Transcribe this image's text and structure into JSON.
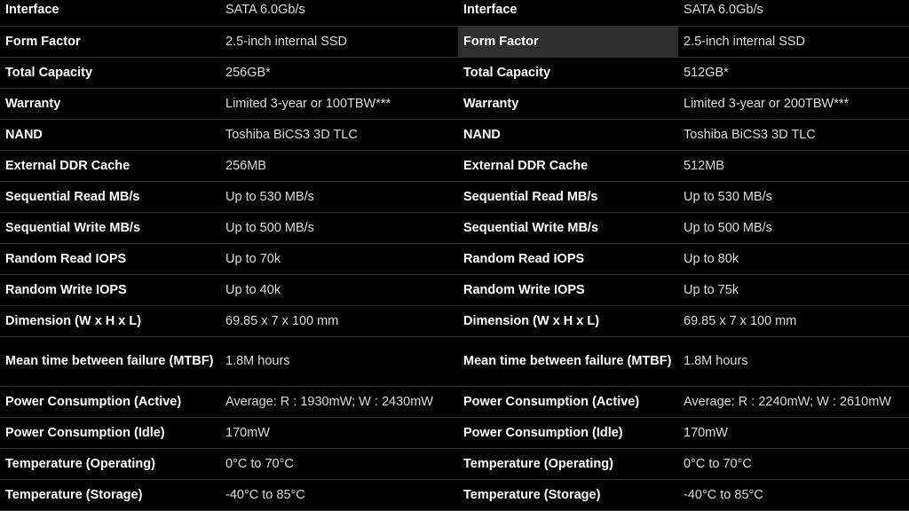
{
  "left_table": {
    "rows": [
      {
        "label": "Interface",
        "value": "SATA 6.0Gb/s"
      },
      {
        "label": "Form Factor",
        "value": "2.5-inch internal SSD"
      },
      {
        "label": "Total Capacity",
        "value": "256GB*"
      },
      {
        "label": "Warranty",
        "value": "Limited 3-year or 100TBW***"
      },
      {
        "label": "NAND",
        "value": "Toshiba BiCS3 3D TLC"
      },
      {
        "label": "External DDR Cache",
        "value": "256MB"
      },
      {
        "label": "Sequential Read MB/s",
        "value": "Up to 530 MB/s"
      },
      {
        "label": "Sequential Write MB/s",
        "value": "Up to 500 MB/s"
      },
      {
        "label": "Random Read IOPS",
        "value": "Up to 70k"
      },
      {
        "label": "Random Write IOPS",
        "value": "Up to 40k"
      },
      {
        "label": "Dimension (W x H x L)",
        "value": "69.85 x 7 x 100 mm"
      },
      {
        "label": "Mean time between failure (MTBF)",
        "value": "1.8M hours"
      },
      {
        "label": "Power Consumption (Active)",
        "value": "Average: R : 1930mW; W : 2430mW"
      },
      {
        "label": "Power Consumption (Idle)",
        "value": "170mW"
      },
      {
        "label": "Temperature (Operating)",
        "value": "0°C to 70°C"
      },
      {
        "label": "Temperature (Storage)",
        "value": "-40°C to 85°C"
      }
    ]
  },
  "right_table": {
    "highlighted_row": "Form Factor",
    "rows": [
      {
        "label": "Interface",
        "value": "SATA 6.0Gb/s"
      },
      {
        "label": "Form Factor",
        "value": "2.5-inch internal SSD"
      },
      {
        "label": "Total Capacity",
        "value": "512GB*"
      },
      {
        "label": "Warranty",
        "value": "Limited 3-year or 200TBW***"
      },
      {
        "label": "NAND",
        "value": "Toshiba BiCS3 3D TLC"
      },
      {
        "label": "External DDR Cache",
        "value": "512MB"
      },
      {
        "label": "Sequential Read MB/s",
        "value": "Up to 530 MB/s"
      },
      {
        "label": "Sequential Write MB/s",
        "value": "Up to 500 MB/s"
      },
      {
        "label": "Random Read IOPS",
        "value": "Up to 80k"
      },
      {
        "label": "Random Write IOPS",
        "value": "Up to 75k"
      },
      {
        "label": "Dimension (W x H x L)",
        "value": "69.85 x 7 x 100 mm"
      },
      {
        "label": "Mean time between failure (MTBF)",
        "value": "1.8M hours"
      },
      {
        "label": "Power Consumption (Active)",
        "value": "Average: R : 2240mW; W : 2610mW"
      },
      {
        "label": "Power Consumption (Idle)",
        "value": "170mW"
      },
      {
        "label": "Temperature (Operating)",
        "value": "0°C to 70°C"
      },
      {
        "label": "Temperature (Storage)",
        "value": "-40°C to 85°C"
      }
    ]
  },
  "colors": {
    "background": "#000000",
    "label_text": "#ffffff",
    "value_text": "#dcdcdc",
    "row_divider": "#2c2c2c",
    "highlight_cell": "#2e2e2e"
  }
}
